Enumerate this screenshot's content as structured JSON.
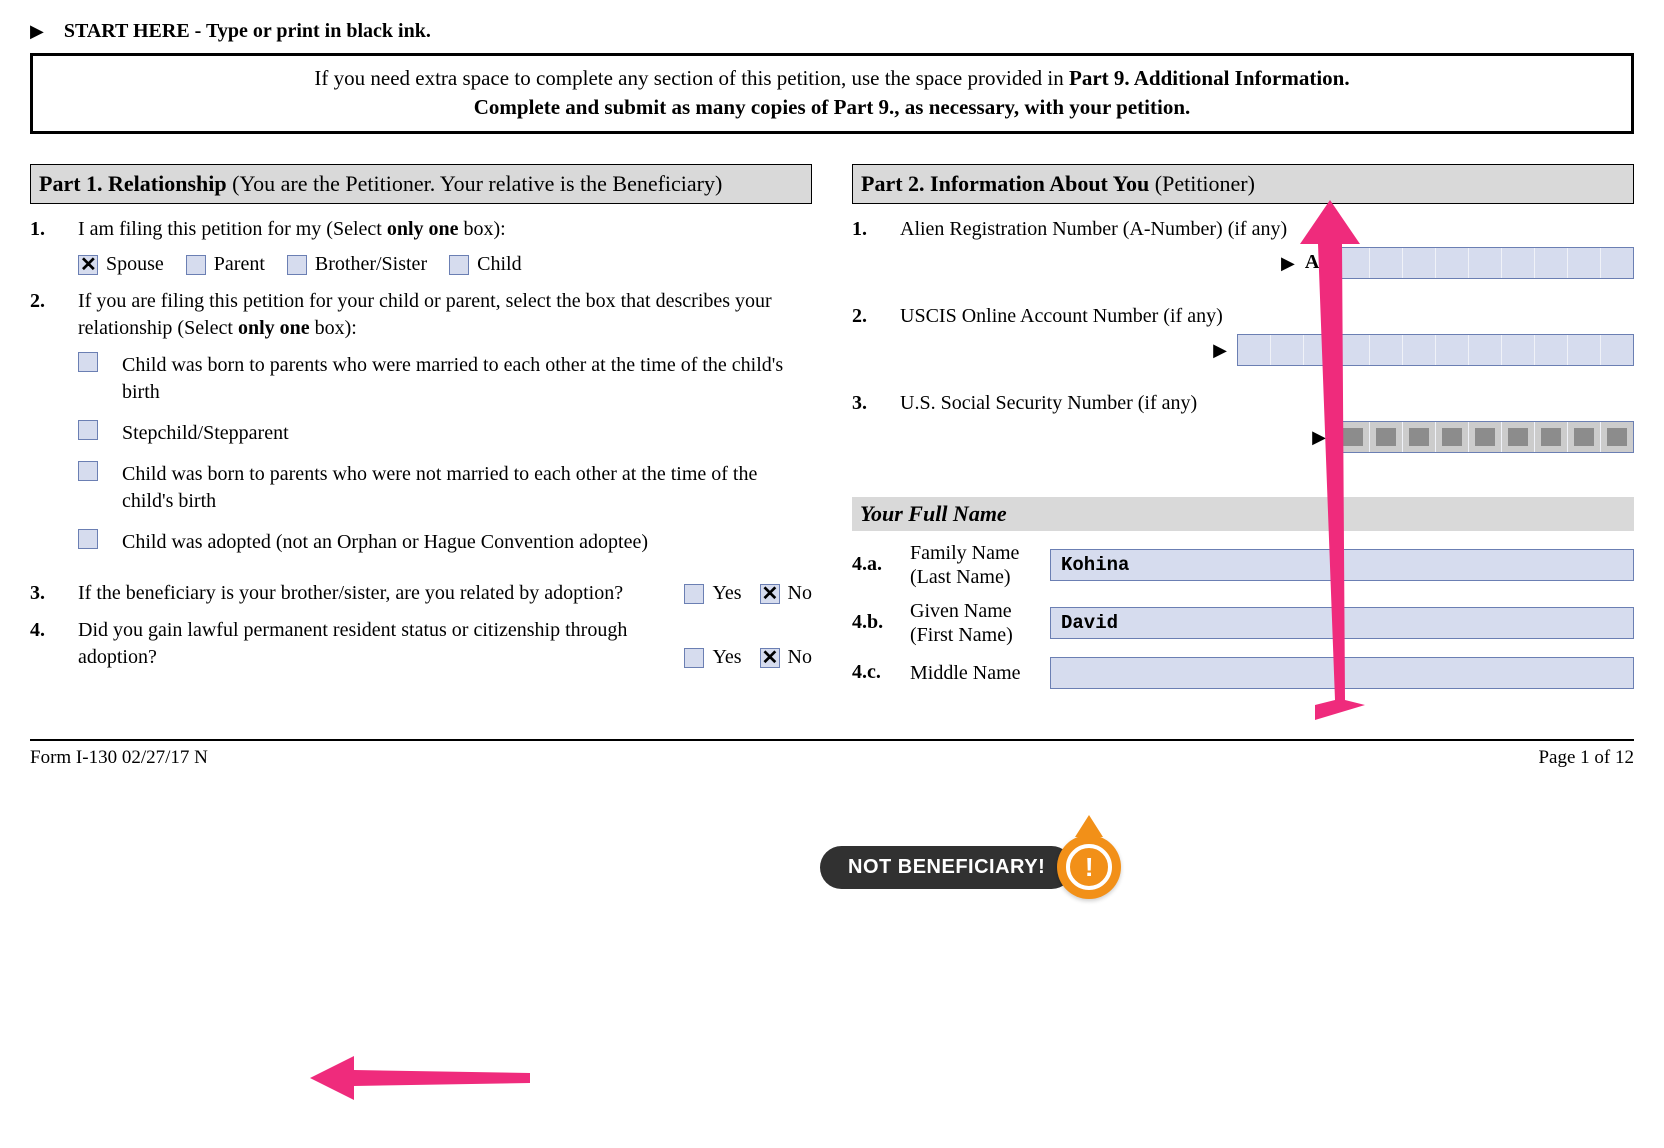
{
  "header": {
    "start_text": "START HERE - Type or print in black ink.",
    "info_box_line1_pre": "If you need extra space to complete any section of this petition, use the space provided in ",
    "info_box_line1_bold": "Part 9. Additional Information.",
    "info_box_line2_bold": "Complete and submit as many copies of Part 9., as necessary, with your petition."
  },
  "part1": {
    "title_bold": "Part 1.  Relationship",
    "title_rest": " (You are the Petitioner.  Your relative is the Beneficiary)",
    "q1_num": "1.",
    "q1_text_pre": "I am filing this petition for my (Select ",
    "q1_text_bold": "only one",
    "q1_text_post": " box):",
    "q1_opts": {
      "spouse": "Spouse",
      "parent": "Parent",
      "brother": "Brother/Sister",
      "child": "Child"
    },
    "q1_selected": "spouse",
    "q2_num": "2.",
    "q2_text_pre": "If you are filing this petition for your child or parent, select the box that describes your relationship (Select ",
    "q2_text_bold": "only one",
    "q2_text_post": " box):",
    "q2_opts": [
      "Child was born to parents who were married to each other at the time of the child's birth",
      "Stepchild/Stepparent",
      "Child was born to parents who were not married to each other at the time of the child's birth",
      "Child was adopted (not an Orphan or Hague Convention adoptee)"
    ],
    "q3_num": "3.",
    "q3_text": "If the beneficiary is your brother/sister, are you related by adoption?",
    "q4_num": "4.",
    "q4_text": "Did you gain lawful permanent resident status or citizenship through adoption?",
    "yes": "Yes",
    "no": "No",
    "q3_answer": "no",
    "q4_answer": "no"
  },
  "part2": {
    "title_bold": "Part 2.  Information About You",
    "title_rest": " (Petitioner)",
    "q1_num": "1.",
    "q1_text": "Alien Registration Number (A-Number) (if any)",
    "a_prefix": "A-",
    "q2_num": "2.",
    "q2_text": "USCIS Online Account Number (if any)",
    "q3_num": "3.",
    "q3_text": "U.S. Social Security Number (if any)",
    "name_header": "Your Full Name",
    "q4a_num": "4.a.",
    "q4a_label": "Family Name",
    "q4a_sub": "(Last Name)",
    "family_name": "Kohina",
    "q4b_num": "4.b.",
    "q4b_label": "Given Name",
    "q4b_sub": "(First Name)",
    "given_name": "David",
    "q4c_num": "4.c.",
    "q4c_label": "Middle Name",
    "middle_name": ""
  },
  "callout": {
    "text": "NOT BENEFICIARY!",
    "badge": "!"
  },
  "footer": {
    "left": "Form I-130   02/27/17   N",
    "right": "Page 1 of 12"
  }
}
